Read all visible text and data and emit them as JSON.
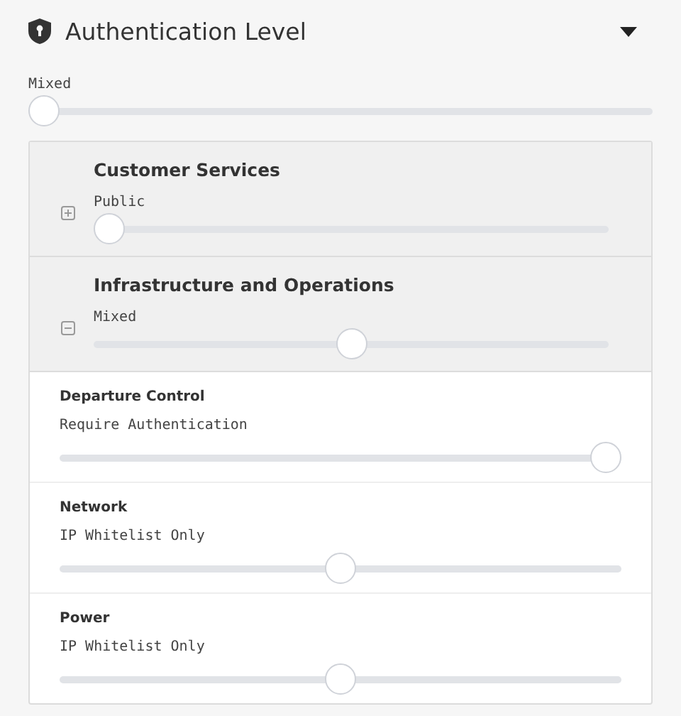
{
  "header": {
    "title": "Authentication Level",
    "expanded": true
  },
  "overall": {
    "value": "Mixed",
    "level": 0
  },
  "groups": [
    {
      "name": "Customer Services",
      "value": "Public",
      "level": 0,
      "expanded": false
    },
    {
      "name": "Infrastructure and Operations",
      "value": "Mixed",
      "level": 0.5,
      "expanded": true,
      "children": [
        {
          "name": "Departure Control",
          "value": "Require Authentication",
          "level": 1
        },
        {
          "name": "Network",
          "value": "IP Whitelist Only",
          "level": 0.5
        },
        {
          "name": "Power",
          "value": "IP Whitelist Only",
          "level": 0.5
        }
      ]
    }
  ]
}
